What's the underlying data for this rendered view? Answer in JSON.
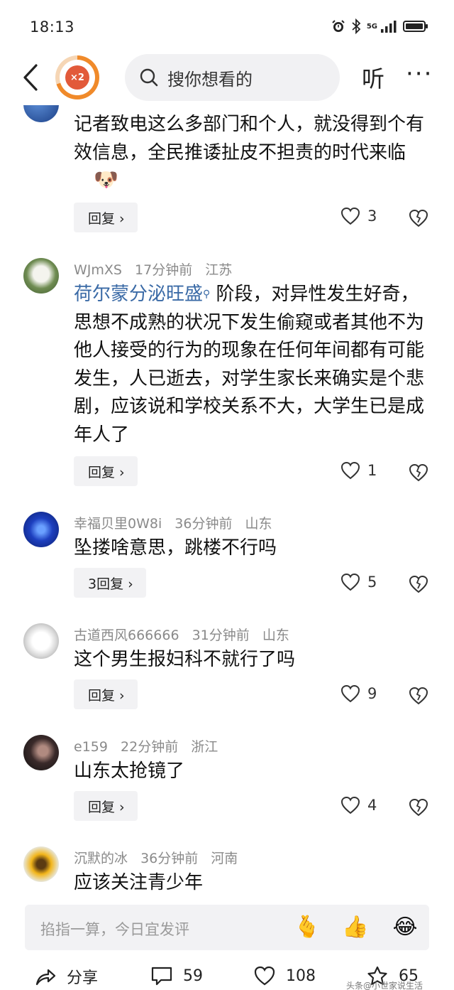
{
  "status_bar": {
    "time": "18:13",
    "network": "5G"
  },
  "nav": {
    "badge_text": "×2",
    "search_placeholder": "搜你想看的",
    "listen_label": "听",
    "more_label": "···"
  },
  "comments": [
    {
      "text": "记者致电这么多部门和个人，就没得到个有效信息，全民推诿扯皮不担责的时代来临",
      "reply_label": "回复 ›",
      "likes": "3"
    },
    {
      "user": "WJmXS",
      "time": "17分钟前",
      "location": "江苏",
      "highlight": "荷尔蒙分泌旺盛",
      "text": " 阶段，对异性发生好奇，思想不成熟的状况下发生偷窥或者其他不为他人接受的行为的现象在任何年间都有可能发生，人已逝去，对学生家长来确实是个悲剧，应该说和学校关系不大，大学生已是成年人了",
      "reply_label": "回复 ›",
      "likes": "1"
    },
    {
      "user": "幸福贝里0W8i",
      "time": "36分钟前",
      "location": "山东",
      "text": "坠搂啥意思，跳楼不行吗",
      "reply_label": "3回复 ›",
      "likes": "5"
    },
    {
      "user": "古道西风666666",
      "time": "31分钟前",
      "location": "山东",
      "text": "这个男生报妇科不就行了吗",
      "reply_label": "回复 ›",
      "likes": "9"
    },
    {
      "user": "e159",
      "time": "22分钟前",
      "location": "浙江",
      "text": "山东太抢镜了",
      "reply_label": "回复 ›",
      "likes": "4"
    },
    {
      "user": "沉默的冰",
      "time": "36分钟前",
      "location": "河南",
      "text": "应该关注青少年"
    }
  ],
  "input": {
    "placeholder": "掐指一算，今日宜发评"
  },
  "bottom_bar": {
    "share_label": "分享",
    "comments_count": "59",
    "likes_count": "108",
    "favorites_count": "65"
  },
  "watermark": "头条@小世家说生活"
}
